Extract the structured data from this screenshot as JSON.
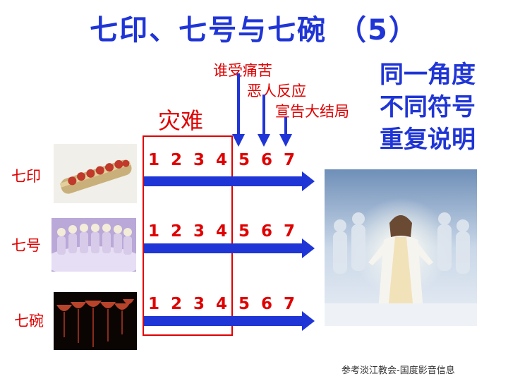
{
  "title": "七印、七号与七碗 （5）",
  "disaster_label": "灾难",
  "notes": [
    "谁受痛苦",
    "恶人反应",
    "宣告大结局"
  ],
  "side_text": [
    "同一角度",
    "不同符号",
    "重复说明"
  ],
  "rows": [
    {
      "label": "七印",
      "numbers": [
        "1",
        "2",
        "3",
        "4",
        "5",
        "6",
        "7"
      ]
    },
    {
      "label": "七号",
      "numbers": [
        "1",
        "2",
        "3",
        "4",
        "5",
        "6",
        "7"
      ]
    },
    {
      "label": "七碗",
      "numbers": [
        "1",
        "2",
        "3",
        "4",
        "5",
        "6",
        "7"
      ]
    }
  ],
  "footer": "参考淡江教会-国度影音信息",
  "colors": {
    "blue": "#1f35d6",
    "red": "#e00000"
  }
}
